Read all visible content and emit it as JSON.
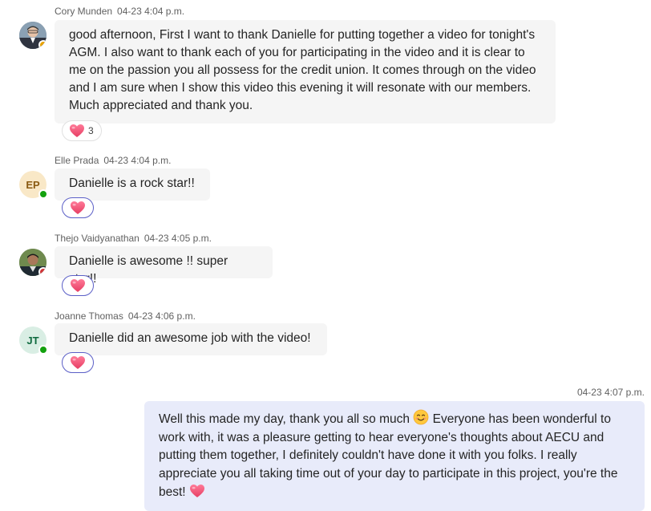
{
  "messages": [
    {
      "author": "Cory Munden",
      "time": "04-23 4:04 p.m.",
      "avatar_type": "photo",
      "presence": "away",
      "text": "good afternoon, First I want to thank Danielle for putting together a video for tonight's AGM. I also want to thank each of you for participating in the video and it is clear to me on the passion you all possess for the credit union. It comes through on the video and I am sure when I show this video this evening it will resonate with our members. Much appreciated and thank you.",
      "reaction": {
        "icon": "heart-icon",
        "count": "3"
      }
    },
    {
      "author": "Elle Prada",
      "time": "04-23 4:04 p.m.",
      "avatar_initials": "EP",
      "avatar_color": "#f9e8c7",
      "avatar_text_color": "#8a5a12",
      "presence": "available",
      "text": "Danielle is a rock star!!",
      "reaction": {
        "icon": "heart-icon"
      }
    },
    {
      "author": "Thejo Vaidyanathan",
      "time": "04-23 4:05 p.m.",
      "avatar_type": "photo",
      "presence": "busy",
      "text": "Danielle is awesome !! super star!!",
      "reaction": {
        "icon": "heart-icon"
      }
    },
    {
      "author": "Joanne Thomas",
      "time": "04-23 4:06 p.m.",
      "avatar_initials": "JT",
      "avatar_color": "#d9eee4",
      "avatar_text_color": "#0e6a3f",
      "presence": "available",
      "text": "Danielle did an awesome job with the video!",
      "reaction": {
        "icon": "heart-icon"
      }
    }
  ],
  "own_message": {
    "time": "04-23 4:07 p.m.",
    "text_part1": "Well this made my day, thank you all so much",
    "emoji1": "smiling-face-icon",
    "text_part2": " Everyone has been wonderful to work with, it was a pleasure getting to hear everyone's thoughts about AECU and putting them together, I definitely couldn't have done it with you folks. I really appreciate you all taking time out of your day to participate in this project, you're the best!",
    "emoji2": "heart-icon"
  },
  "colors": {
    "heart": "#f25b7d",
    "accent": "#5b5fc7",
    "available": "#13a10e",
    "away": "#eaa300",
    "busy": "#d13438",
    "own_bubble": "#e8ebfa",
    "other_bubble": "#f5f5f5"
  }
}
